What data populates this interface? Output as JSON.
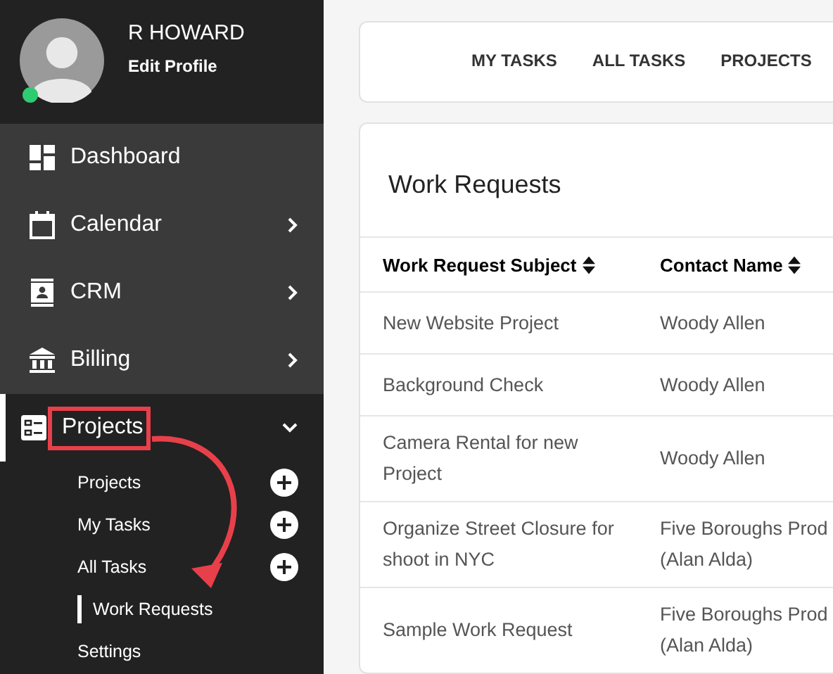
{
  "profile": {
    "name": "R HOWARD",
    "link": "Edit Profile",
    "online": true
  },
  "nav": [
    {
      "kind": "link",
      "label": "Dashboard",
      "selected": false,
      "highlighted": false
    },
    {
      "kind": "group",
      "label": "Calendar",
      "expanded": false,
      "selected": false,
      "highlighted": false
    },
    {
      "kind": "group",
      "label": "CRM",
      "expanded": false,
      "selected": false,
      "highlighted": false
    },
    {
      "kind": "group",
      "label": "Billing",
      "expanded": false,
      "selected": false,
      "highlighted": false
    },
    {
      "kind": "group",
      "label": "Projects",
      "expanded": true,
      "selected": true,
      "highlighted": true
    }
  ],
  "subnav": [
    {
      "label": "Projects",
      "add": true,
      "selected": false
    },
    {
      "label": "My Tasks",
      "add": true,
      "selected": false
    },
    {
      "label": "All Tasks",
      "add": true,
      "selected": false
    },
    {
      "label": "Work Requests",
      "add": false,
      "selected": true
    },
    {
      "label": "Settings",
      "add": false,
      "selected": false
    }
  ],
  "tabs": [
    {
      "label": "MY TASKS",
      "selected": false
    },
    {
      "label": "ALL TASKS",
      "selected": false
    },
    {
      "label": "PROJECTS",
      "selected": false
    }
  ],
  "panel": {
    "title": "Work Requests",
    "columns": [
      "Work Request Subject",
      "Contact Name"
    ],
    "rows": [
      [
        "New Website Project",
        "Woody Allen"
      ],
      [
        "Background Check",
        "Woody Allen"
      ],
      [
        "Camera Rental for new\nProject",
        "Woody Allen"
      ],
      [
        "Organize Street Closure for\nshoot in NYC",
        "Five Boroughs Prod\n(Alan Alda)"
      ],
      [
        "Sample Work Request",
        "Five Boroughs Prod\n(Alan Alda)"
      ]
    ]
  }
}
